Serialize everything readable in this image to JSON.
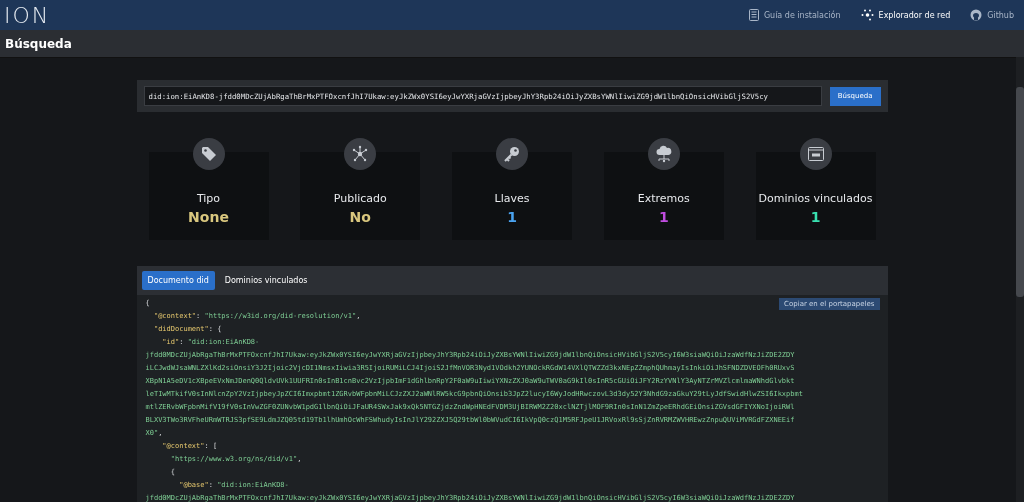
{
  "header": {
    "logo": "ION",
    "links": [
      {
        "label": "Guía de instalación",
        "selected": false
      },
      {
        "label": "Explorador de red",
        "selected": true
      },
      {
        "label": "Github",
        "selected": false
      }
    ]
  },
  "page_title": "Búsqueda",
  "search": {
    "value": "did:ion:EiAnKD8-jfdd0MDcZUjAbRgaThBrMxPTFOxcnfJhI7Ukaw:eyJkZWx0YSI6eyJwYXRjaGVzIjpbeyJhY3Rpb24iOiJyZXBsYWNlIiwiZG9jdW1lbnQiOnsicHVibGljS2V5cy",
    "button": "Búsqueda"
  },
  "stats": [
    {
      "label": "Tipo",
      "value": "None",
      "color": "#d9c77e"
    },
    {
      "label": "Publicado",
      "value": "No",
      "color": "#d9c77e"
    },
    {
      "label": "Llaves",
      "value": "1",
      "color": "#4aa3f0"
    },
    {
      "label": "Extremos",
      "value": "1",
      "color": "#c04de0"
    },
    {
      "label": "Dominios vinculados",
      "value": "1",
      "color": "#38e0b0"
    }
  ],
  "document": {
    "tabs": [
      {
        "label": "Documento did",
        "selected": true
      },
      {
        "label": "Dominios vinculados",
        "selected": false
      }
    ],
    "copy_button": "Copiar en el portapapeles",
    "code_lines": [
      [
        {
          "kind": "punct",
          "text": "{"
        }
      ],
      [
        {
          "kind": "key",
          "text": "  \"@context\""
        },
        {
          "kind": "punct",
          "text": ": "
        },
        {
          "kind": "string",
          "text": "\"https://w3id.org/did-resolution/v1\""
        },
        {
          "kind": "punct",
          "text": ","
        }
      ],
      [
        {
          "kind": "key",
          "text": "  \"didDocument\""
        },
        {
          "kind": "punct",
          "text": ": {"
        }
      ],
      [
        {
          "kind": "key",
          "text": "    \"id\""
        },
        {
          "kind": "punct",
          "text": ": "
        },
        {
          "kind": "string",
          "text": "\"did:ion:EiAnKD8-"
        }
      ],
      [
        {
          "kind": "string",
          "text": "jfdd0MDcZUjAbRgaThBrMxPTFOxcnfJhI7Ukaw:eyJkZWx0YSI6eyJwYXRjaGVzIjpbeyJhY3Rpb24iOiJyZXBsYWNlIiwiZG9jdW1lbnQiOnsicHVibGljS2V5cyI6W3siaWQiOiJzaWdfNzJiZDE2ZDY"
        }
      ],
      [
        {
          "kind": "string",
          "text": "iLCJwdWJsaWNLZXlKd2siOnsiY3J2Ijoic2VjcDI1NmsxIiwia3R5IjoiRUMiLCJ4IjoiS2JfMnVOR3Nyd1VOdkh2YUNOckRGdW14VXlQTWZZd3kxNEpZZmphQUhmayIsInkiOiJhSFNDZDVEOFh0RUxvS"
        }
      ],
      [
        {
          "kind": "string",
          "text": "XBpN1A5eDV1cXBpeEVxNmJDenQ0QldvUVk1UUFRIn0sInB1cnBvc2VzIjpbImF1dGhlbnRpY2F0aW9uIiwiYXNzZXJ0aW9uTWV0aG9kIl0sInR5cGUiOiJFY2RzYVNlY3AyNTZrMVZlcmlmaWNhdGlvbkt"
        }
      ],
      [
        {
          "kind": "string",
          "text": "leTIwMTkifV0sInNlcnZpY2VzIjpbeyJpZCI6Imxpbmt1ZGRvbWFpbnMiLCJzZXJ2aWNlRW5kcG9pbnQiOnsib3JpZ2lucyI6WyJodHRwczovL3d3dy52Y3NhdG9zaGkuY29tLyJdfSwidHlwZSI6Ikxpbmt"
        }
      ],
      [
        {
          "kind": "string",
          "text": "mtlZERvbWFpbnMifV19fV0sInVwZGF0ZUNvbW1pdG1lbnQiOiJFaUR4SWxJak9xQk5NTGZjdzZndWpHNEdFVDM3UjBIRWM2Z20xclNZTjlMOF9RIn0sInN1ZmZpeERhdGEiOnsiZGVsdGFIYXNoIjoiRWl"
        }
      ],
      [
        {
          "kind": "string",
          "text": "BLXV3TWo3RVFheURmWTRJS3pfSE9LdmJZQ05td19Tb1lhUmhOcWhFSWhudyIsInJlY292ZXJ5Q29tbWl0bWVudCI6IkVpQ0czQ1M5RFJpeU1JRVoxRl9sSjZnRVRMZWVHREwzZnpuQUViMVRGdFZXNEEif"
        }
      ],
      [
        {
          "kind": "string",
          "text": "X0\""
        },
        {
          "kind": "punct",
          "text": ","
        }
      ],
      [
        {
          "kind": "key",
          "text": "    \"@context\""
        },
        {
          "kind": "punct",
          "text": ": ["
        }
      ],
      [
        {
          "kind": "string",
          "text": "      \"https://www.w3.org/ns/did/v1\""
        },
        {
          "kind": "punct",
          "text": ","
        }
      ],
      [
        {
          "kind": "punct",
          "text": "      {"
        }
      ],
      [
        {
          "kind": "key",
          "text": "        \"@base\""
        },
        {
          "kind": "punct",
          "text": ": "
        },
        {
          "kind": "string",
          "text": "\"did:ion:EiAnKD8-"
        }
      ],
      [
        {
          "kind": "string",
          "text": "jfdd0MDcZUjAbRgaThBrMxPTFOxcnfJhI7Ukaw:eyJkZWx0YSI6eyJwYXRjaGVzIjpbeyJhY3Rpb24iOiJyZXBsYWNlIiwiZG9jdW1lbnQiOnsicHVibGljS2V5cyI6W3siaWQiOiJzaWdfNzJiZDE2ZDY"
        }
      ]
    ]
  }
}
